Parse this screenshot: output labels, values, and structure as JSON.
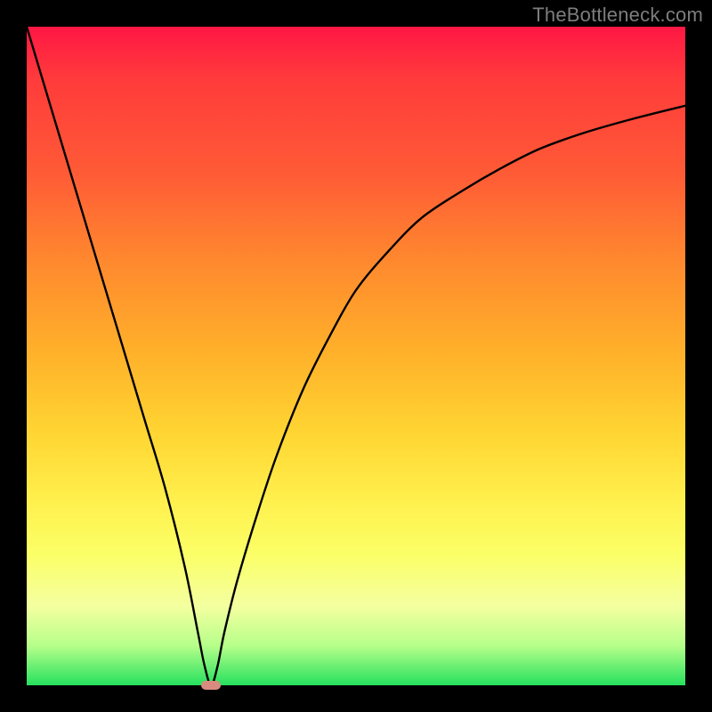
{
  "watermark": "TheBottleneck.com",
  "chart_data": {
    "type": "line",
    "title": "",
    "xlabel": "",
    "ylabel": "",
    "xlim": [
      0,
      100
    ],
    "ylim": [
      0,
      100
    ],
    "background_gradient": [
      "#ff1744",
      "#ff8a2e",
      "#ffd633",
      "#fbff66",
      "#26e05e"
    ],
    "min_x": 28,
    "series": [
      {
        "name": "curve",
        "x": [
          0,
          3,
          6,
          9,
          12,
          15,
          18,
          21,
          24,
          26,
          27,
          28,
          29,
          30,
          32,
          35,
          38,
          42,
          46,
          50,
          55,
          60,
          66,
          72,
          78,
          85,
          92,
          100
        ],
        "values": [
          100,
          90,
          80,
          70,
          60,
          50,
          40,
          30,
          18,
          8,
          3,
          0,
          3,
          8,
          16,
          26,
          35,
          45,
          53,
          60,
          66,
          71,
          75,
          78.5,
          81.5,
          84,
          86,
          88
        ]
      }
    ],
    "marker": {
      "x": 28,
      "y": 0,
      "color": "#d98b7f"
    }
  }
}
